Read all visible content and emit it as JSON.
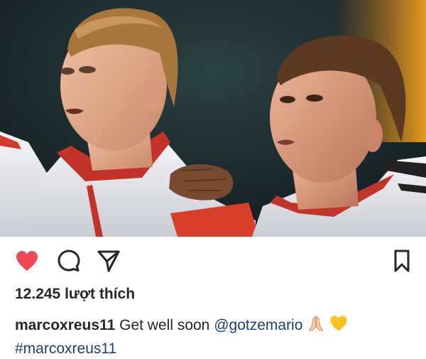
{
  "post": {
    "image_alt": "Marco Reus and Mario Götze in national team jackets",
    "likes_count": "12.245",
    "likes_label": "lượt thích",
    "username": "marcoxreus11",
    "caption_text": "Get well soon",
    "mention": "@gotzemario",
    "hashtag": "#marcoxreus11",
    "emojis": [
      "folded-hands",
      "yellow-heart"
    ]
  },
  "actions": {
    "like_icon": "heart-icon",
    "comment_icon": "comment-icon",
    "share_icon": "send-icon",
    "save_icon": "bookmark-icon",
    "liked": true
  },
  "colors": {
    "like_red": "#ed4956",
    "text": "#262626",
    "link": "#1d3f73"
  }
}
